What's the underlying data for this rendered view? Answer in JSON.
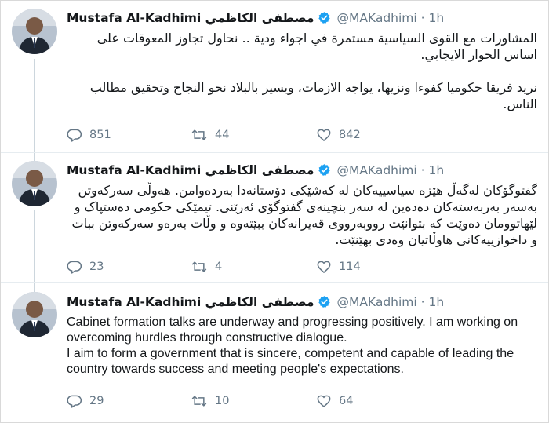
{
  "tweets": [
    {
      "name": "Mustafa Al-Kadhimi مصطفى الكاظمي",
      "handle": "@MAKadhimi",
      "dot": "·",
      "time": "1h",
      "text": "المشاورات مع القوى السياسية مستمرة في اجواء ودية .. نحاول تجاوز المعوقات على اساس الحوار الايجابي.\n\nنريد فريقا حكوميا كفوءا ونزيها، يواجه الازمات، ويسير بالبلاد نحو النجاح وتحقيق مطالب الناس.",
      "replies": "851",
      "retweets": "44",
      "likes": "842"
    },
    {
      "name": "Mustafa Al-Kadhimi مصطفى الكاظمي",
      "handle": "@MAKadhimi",
      "dot": "·",
      "time": "1h",
      "text": "گفتوگۆکان لەگەڵ هێزە سیاسییەکان لە کەشێکی دۆستانەدا بەردەوامن. هەوڵی سەرکەوتن بەسەر بەربەستەکان دەدەین لە سەر بنچینەی گفتوگۆی ئەرێنی. تیمێکی حکومی دەستپاک و لێهاتوومان دەوێت کە بتوانێت رووبەرووی قەیرانەکان ببێتەوە و وڵات بەرەو سەرکەوتن ببات و داخوازییەکانی هاوڵاتیان وەدی بهێنێت.",
      "replies": "23",
      "retweets": "4",
      "likes": "114"
    },
    {
      "name": "Mustafa Al-Kadhimi مصطفى الكاظمي",
      "handle": "@MAKadhimi",
      "dot": "·",
      "time": "1h",
      "text": "Cabinet formation talks are underway and progressing positively. I am working on overcoming hurdles through constructive dialogue.\nI aim to form a government that is sincere, competent and capable of leading the country towards success and meeting people's expectations.",
      "replies": "29",
      "retweets": "10",
      "likes": "64"
    }
  ],
  "icons": {
    "reply": "reply-icon",
    "retweet": "retweet-icon",
    "like": "heart-icon",
    "verified": "verified-badge-icon"
  },
  "colors": {
    "verified": "#1da1f2",
    "muted": "#657786",
    "thread_line": "#ccd6dd",
    "text": "#14171a"
  }
}
